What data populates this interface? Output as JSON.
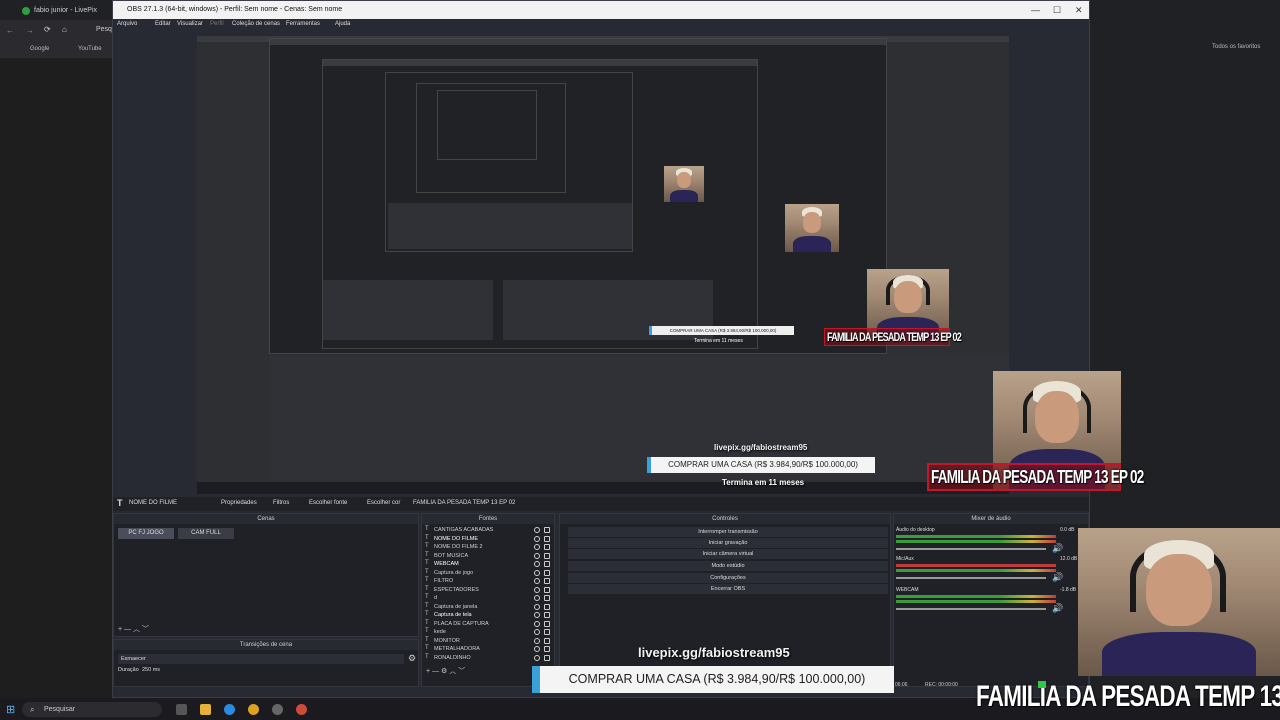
{
  "browser": {
    "tab_title": "fabio junior - LivePix",
    "search_partial": "Pesqu",
    "bookmarks": [
      "Google",
      "YouTube"
    ],
    "bookmarks_right": "Todos os favoritos"
  },
  "obs": {
    "title": "OBS 27.1.3 (64-bit, windows) - Perfil: Sem nome - Cenas: Sem nome",
    "menu": [
      "Arquivo",
      "Editar",
      "Visualizar",
      "Perfil",
      "Coleção de cenas",
      "Ferramentas",
      "Ajuda"
    ],
    "source_bar": {
      "selected_source": "NOME DO FILME",
      "properties": "Propriedades",
      "filters": "Filtros",
      "choose_font": "Escolher fonte",
      "choose_color": "Escolher cor",
      "text_value": "FAMILIA DA PESADA TEMP 13 EP 02"
    },
    "scenes": {
      "title": "Cenas",
      "items": [
        "PC FJ JOGO",
        "CAM FULL"
      ]
    },
    "transitions": {
      "title": "Transições de cena",
      "type": "Esmaecer",
      "duration_label": "Duração",
      "duration_value": "250 ms"
    },
    "sources": {
      "title": "Fontes",
      "items": [
        "CANTIGAS ACABADAS",
        "NOME DO FILME",
        "NOME DO FILME 2",
        "BOT MUSICA",
        "WEBCAM",
        "Captura de jogo",
        "FILTRO",
        "ESPECTADORES",
        "d",
        "Captura de janela",
        "Captura de tela",
        "PLACA DE CAPTURA",
        "kede",
        "MONITOR",
        "METRALHADORA",
        "RONALDINHO"
      ]
    },
    "controls": {
      "title": "Controles",
      "items": [
        "Interromper transmissão",
        "Iniciar gravação",
        "Iniciar câmera virtual",
        "Modo estúdio",
        "Configurações",
        "Encerrar OBS"
      ]
    },
    "mixer": {
      "title": "Mixer de áudio",
      "channels": [
        {
          "name": "Áudio do desktop",
          "db": "0.0 dB"
        },
        {
          "name": "Mic/Aux",
          "db": "12.0 dB"
        },
        {
          "name": "WEBCAM",
          "db": "-1.8 dB"
        }
      ]
    },
    "status": {
      "time": "06:06",
      "rec": "REC: 00:00:00"
    }
  },
  "overlay": {
    "site": "livepix.gg/fabiostream95",
    "buy": "COMPRAR UMA CASA (R$ 3.984,90/R$ 100.000,00)",
    "term": "Termina em 11 meses",
    "show": "FAMILIA DA PESADA TEMP 13 EP 02"
  },
  "taskbar": {
    "search": "Pesquisar"
  },
  "colors": {
    "obs_bg": "#272a33",
    "dock_bg": "#1f2127",
    "buy_accent": "#3aa0d8",
    "show_red": "#c01828"
  }
}
